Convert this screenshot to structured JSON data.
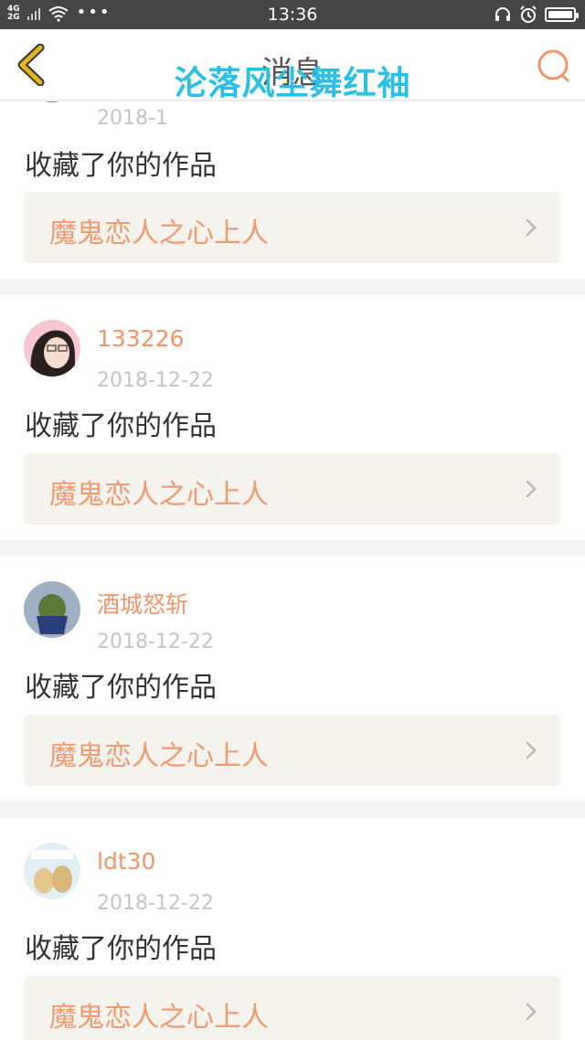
{
  "status_bar": {
    "network_labels": [
      "4G",
      "2G"
    ],
    "time": "13:36",
    "icons": [
      "signal-icon",
      "wifi-icon",
      "more-dots-icon",
      "headset-icon",
      "alarm-icon",
      "battery-icon"
    ],
    "battery_level": 1.0
  },
  "nav": {
    "title": "消息",
    "back_icon": "chevron-left-icon",
    "search_icon": "search-icon"
  },
  "watermark": "沦落风尘舞红袖",
  "colors": {
    "accent": "#f0956a",
    "back_chevron": "#e7b21e",
    "watermark": "#28c0e6",
    "work_bg": "#f4f3ee"
  },
  "messages": [
    {
      "username": "",
      "date": "2018-1",
      "action": "收藏了你的作品",
      "work_title": "魔鬼恋人之心上人"
    },
    {
      "username": "133226",
      "date": "2018-12-22",
      "action": "收藏了你的作品",
      "work_title": "魔鬼恋人之心上人"
    },
    {
      "username": "酒城怒斩",
      "date": "2018-12-22",
      "action": "收藏了你的作品",
      "work_title": "魔鬼恋人之心上人"
    },
    {
      "username": "ldt30",
      "date": "2018-12-22",
      "action": "收藏了你的作品",
      "work_title": "魔鬼恋人之心上人"
    }
  ]
}
